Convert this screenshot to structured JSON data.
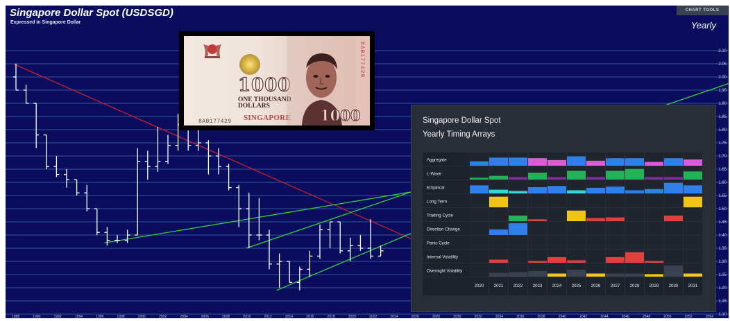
{
  "header": {
    "title": "Singapore Dollar Spot (USDSGD)",
    "subtitle": "Expressed in Singapore Dollar",
    "chart_tools_label": "CHART TOOLS",
    "period": "Yearly"
  },
  "banknote": {
    "denomination": "1000",
    "words_line1": "ONE THOUSAND",
    "words_line2": "DOLLARS",
    "country": "SINGAPORE",
    "serial": "8AB177429"
  },
  "colors": {
    "background": "#0a0d5e",
    "grid": "#3a63a8",
    "bars": "#ffffff",
    "downtrend_line": "#c8202c",
    "uptrend_lines": "#35d03f",
    "panel": "#282d36",
    "array_blue": "#2f7fe6",
    "array_pink": "#d65fd6",
    "array_green": "#25b05a",
    "array_cyan": "#33d6d6",
    "array_yellow": "#f2c417",
    "array_red": "#e0413c",
    "array_purple": "#7a2f9a",
    "array_dark": "#3a4150"
  },
  "chart_data": [
    {
      "type": "bar",
      "style": "ohlc",
      "title": "Singapore Dollar Spot (USDSGD)",
      "subtitle": "Expressed in Singapore Dollar",
      "period": "Yearly",
      "x_ticks": [
        "1988",
        "1990",
        "1992",
        "1994",
        "1996",
        "1998",
        "2000",
        "2002",
        "2004",
        "2006",
        "2008",
        "2010",
        "2012",
        "2014",
        "2016",
        "2018",
        "2020",
        "2022",
        "2024",
        "2026",
        "2028",
        "2030",
        "2032",
        "2034",
        "2036",
        "2038",
        "2040",
        "2042",
        "2044",
        "2046",
        "2048",
        "2050",
        "2052",
        "2054"
      ],
      "y_tick_values": [
        2.1,
        2.05,
        2.0,
        1.95,
        1.9,
        1.85,
        1.8,
        1.75,
        1.7,
        1.65,
        1.6,
        1.55,
        1.5,
        1.45,
        1.4,
        1.35,
        1.3,
        1.25,
        1.2,
        1.15,
        1.1
      ],
      "ylim": [
        1.1,
        2.1
      ],
      "grid": "horizontal",
      "bars": [
        {
          "year": 1985,
          "open": 2.0,
          "high": 2.05,
          "low": 1.95,
          "close": 1.95
        },
        {
          "year": 1986,
          "open": 1.95,
          "high": 1.97,
          "low": 1.9,
          "close": 1.9
        },
        {
          "year": 1987,
          "open": 1.9,
          "high": 1.9,
          "low": 1.73,
          "close": 1.78
        },
        {
          "year": 1988,
          "open": 1.78,
          "high": 1.78,
          "low": 1.65,
          "close": 1.66
        },
        {
          "year": 1989,
          "open": 1.66,
          "high": 1.7,
          "low": 1.62,
          "close": 1.63
        },
        {
          "year": 1990,
          "open": 1.63,
          "high": 1.65,
          "low": 1.58,
          "close": 1.61
        },
        {
          "year": 1991,
          "open": 1.61,
          "high": 1.61,
          "low": 1.55,
          "close": 1.56
        },
        {
          "year": 1992,
          "open": 1.56,
          "high": 1.59,
          "low": 1.49,
          "close": 1.5
        },
        {
          "year": 1993,
          "open": 1.5,
          "high": 1.5,
          "low": 1.4,
          "close": 1.41
        },
        {
          "year": 1994,
          "open": 1.41,
          "high": 1.43,
          "low": 1.36,
          "close": 1.38
        },
        {
          "year": 1995,
          "open": 1.38,
          "high": 1.4,
          "low": 1.37,
          "close": 1.38
        },
        {
          "year": 1996,
          "open": 1.38,
          "high": 1.42,
          "low": 1.37,
          "close": 1.4
        },
        {
          "year": 1997,
          "open": 1.4,
          "high": 1.73,
          "low": 1.4,
          "close": 1.68
        },
        {
          "year": 1998,
          "open": 1.68,
          "high": 1.72,
          "low": 1.61,
          "close": 1.66
        },
        {
          "year": 1999,
          "open": 1.66,
          "high": 1.81,
          "low": 1.64,
          "close": 1.68
        },
        {
          "year": 2000,
          "open": 1.68,
          "high": 1.78,
          "low": 1.67,
          "close": 1.74
        },
        {
          "year": 2001,
          "open": 1.74,
          "high": 1.86,
          "low": 1.72,
          "close": 1.82
        },
        {
          "year": 2002,
          "open": 1.82,
          "high": 1.86,
          "low": 1.72,
          "close": 1.74
        },
        {
          "year": 2003,
          "open": 1.74,
          "high": 1.87,
          "low": 1.72,
          "close": 1.75
        },
        {
          "year": 2004,
          "open": 1.75,
          "high": 1.76,
          "low": 1.63,
          "close": 1.7
        },
        {
          "year": 2005,
          "open": 1.7,
          "high": 1.73,
          "low": 1.63,
          "close": 1.66
        },
        {
          "year": 2006,
          "open": 1.66,
          "high": 1.67,
          "low": 1.57,
          "close": 1.58
        },
        {
          "year": 2007,
          "open": 1.58,
          "high": 1.59,
          "low": 1.43,
          "close": 1.5
        },
        {
          "year": 2008,
          "open": 1.5,
          "high": 1.56,
          "low": 1.35,
          "close": 1.4
        },
        {
          "year": 2009,
          "open": 1.4,
          "high": 1.54,
          "low": 1.38,
          "close": 1.4
        },
        {
          "year": 2010,
          "open": 1.4,
          "high": 1.42,
          "low": 1.27,
          "close": 1.29
        },
        {
          "year": 2011,
          "open": 1.29,
          "high": 1.33,
          "low": 1.2,
          "close": 1.3
        },
        {
          "year": 2012,
          "open": 1.3,
          "high": 1.3,
          "low": 1.22,
          "close": 1.22
        },
        {
          "year": 2013,
          "open": 1.22,
          "high": 1.28,
          "low": 1.19,
          "close": 1.27
        },
        {
          "year": 2014,
          "open": 1.27,
          "high": 1.34,
          "low": 1.24,
          "close": 1.32
        },
        {
          "year": 2015,
          "open": 1.32,
          "high": 1.44,
          "low": 1.31,
          "close": 1.42
        },
        {
          "year": 2016,
          "open": 1.42,
          "high": 1.45,
          "low": 1.35,
          "close": 1.45
        },
        {
          "year": 2017,
          "open": 1.45,
          "high": 1.45,
          "low": 1.33,
          "close": 1.34
        },
        {
          "year": 2018,
          "open": 1.34,
          "high": 1.39,
          "low": 1.3,
          "close": 1.36
        },
        {
          "year": 2019,
          "open": 1.36,
          "high": 1.4,
          "low": 1.34,
          "close": 1.35
        },
        {
          "year": 2020,
          "open": 1.35,
          "high": 1.46,
          "low": 1.31,
          "close": 1.32
        },
        {
          "year": 2021,
          "open": 1.32,
          "high": 1.36,
          "low": 1.32,
          "close": 1.34
        }
      ],
      "trendlines": [
        {
          "name": "downtrend",
          "color": "red",
          "from": [
            1985,
            2.05
          ],
          "to": [
            2040,
            1.12
          ]
        },
        {
          "name": "uptrend-1",
          "color": "green",
          "from": [
            1994,
            1.37
          ],
          "to": [
            2030,
            1.6
          ]
        },
        {
          "name": "uptrend-2",
          "color": "green",
          "from": [
            2008,
            1.35
          ],
          "to": [
            2056,
            1.98
          ]
        },
        {
          "name": "uptrend-3",
          "color": "green",
          "from": [
            2011,
            1.19
          ],
          "to": [
            2030,
            1.5
          ]
        }
      ]
    },
    {
      "type": "heatmap",
      "title": "Singapore Dollar Spot",
      "subtitle": "Yearly Timing Arrays",
      "years": [
        "2020",
        "2021",
        "2022",
        "2023",
        "2024",
        "2025",
        "2026",
        "2027",
        "2028",
        "2029",
        "2030",
        "2031"
      ],
      "rows": [
        {
          "label": "Aggregate",
          "values": [
            0.35,
            0.65,
            0.65,
            0.6,
            0.45,
            0.75,
            0.4,
            0.6,
            0.6,
            0.3,
            0.6,
            0.5
          ],
          "colors": [
            "blue",
            "blue",
            "blue",
            "pink",
            "pink",
            "blue",
            "pink",
            "blue",
            "blue",
            "pink",
            "blue",
            "pink"
          ]
        },
        {
          "label": "L-Wave",
          "values": [
            0.15,
            0.3,
            0.2,
            0.55,
            0.2,
            0.7,
            0.2,
            0.7,
            0.85,
            0.2,
            0.2,
            0.65
          ],
          "colors": [
            "green",
            "green",
            "purple",
            "green",
            "purple",
            "green",
            "purple",
            "green",
            "green",
            "purple",
            "purple",
            "green"
          ]
        },
        {
          "label": "Empirical",
          "values": [
            0.65,
            0.3,
            0.2,
            0.5,
            0.6,
            0.25,
            0.45,
            0.55,
            0.25,
            0.35,
            0.85,
            0.65
          ],
          "colors": [
            "blue",
            "cyan",
            "cyan",
            "blue",
            "blue",
            "cyan",
            "blue",
            "blue",
            "blue",
            "blue",
            "blue",
            "blue"
          ]
        },
        {
          "label": "Long Term",
          "values": [
            0,
            0.85,
            0,
            0,
            0,
            0,
            0,
            0,
            0,
            0,
            0,
            0.85
          ],
          "colors": [
            "yellow",
            "yellow",
            "yellow",
            "yellow",
            "yellow",
            "yellow",
            "yellow",
            "yellow",
            "yellow",
            "yellow",
            "yellow",
            "yellow"
          ]
        },
        {
          "label": "Trading Cycle",
          "values": [
            0,
            0,
            0.45,
            0.15,
            0,
            0.85,
            0.25,
            0.3,
            0,
            0,
            0.45,
            0
          ],
          "colors": [
            "green",
            "green",
            "green",
            "red",
            "red",
            "yellow",
            "red",
            "red",
            "red",
            "red",
            "red",
            "red"
          ]
        },
        {
          "label": "Direction Change",
          "values": [
            0,
            0.45,
            0.95,
            0,
            0,
            0,
            0,
            0,
            0,
            0,
            0,
            0
          ],
          "colors": [
            "blue",
            "blue",
            "blue",
            "blue",
            "blue",
            "blue",
            "blue",
            "blue",
            "blue",
            "blue",
            "blue",
            "blue"
          ]
        },
        {
          "label": "Panic Cycle",
          "values": [
            0,
            0,
            0,
            0,
            0,
            0,
            0,
            0,
            0,
            0,
            0,
            0
          ],
          "colors": [
            "red",
            "red",
            "red",
            "red",
            "red",
            "red",
            "red",
            "red",
            "red",
            "red",
            "red",
            "red"
          ]
        },
        {
          "label": "Internal Volatility",
          "values": [
            0,
            0.25,
            0,
            0.15,
            0.45,
            0.2,
            0,
            0.45,
            0.85,
            0.15,
            0,
            0
          ],
          "colors": [
            "red",
            "red",
            "red",
            "red",
            "red",
            "red",
            "red",
            "red",
            "red",
            "red",
            "red",
            "red"
          ]
        },
        {
          "label": "Overnight Volatility",
          "values": [
            0,
            0.3,
            0.35,
            0.45,
            0.25,
            0.55,
            0.25,
            0.25,
            0.25,
            0.2,
            0.9,
            0.25
          ],
          "colors": [
            "dark",
            "dark",
            "dark",
            "dark",
            "yellow",
            "dark",
            "yellow",
            "dark",
            "dark",
            "yellow",
            "dark",
            "yellow"
          ]
        }
      ]
    }
  ]
}
